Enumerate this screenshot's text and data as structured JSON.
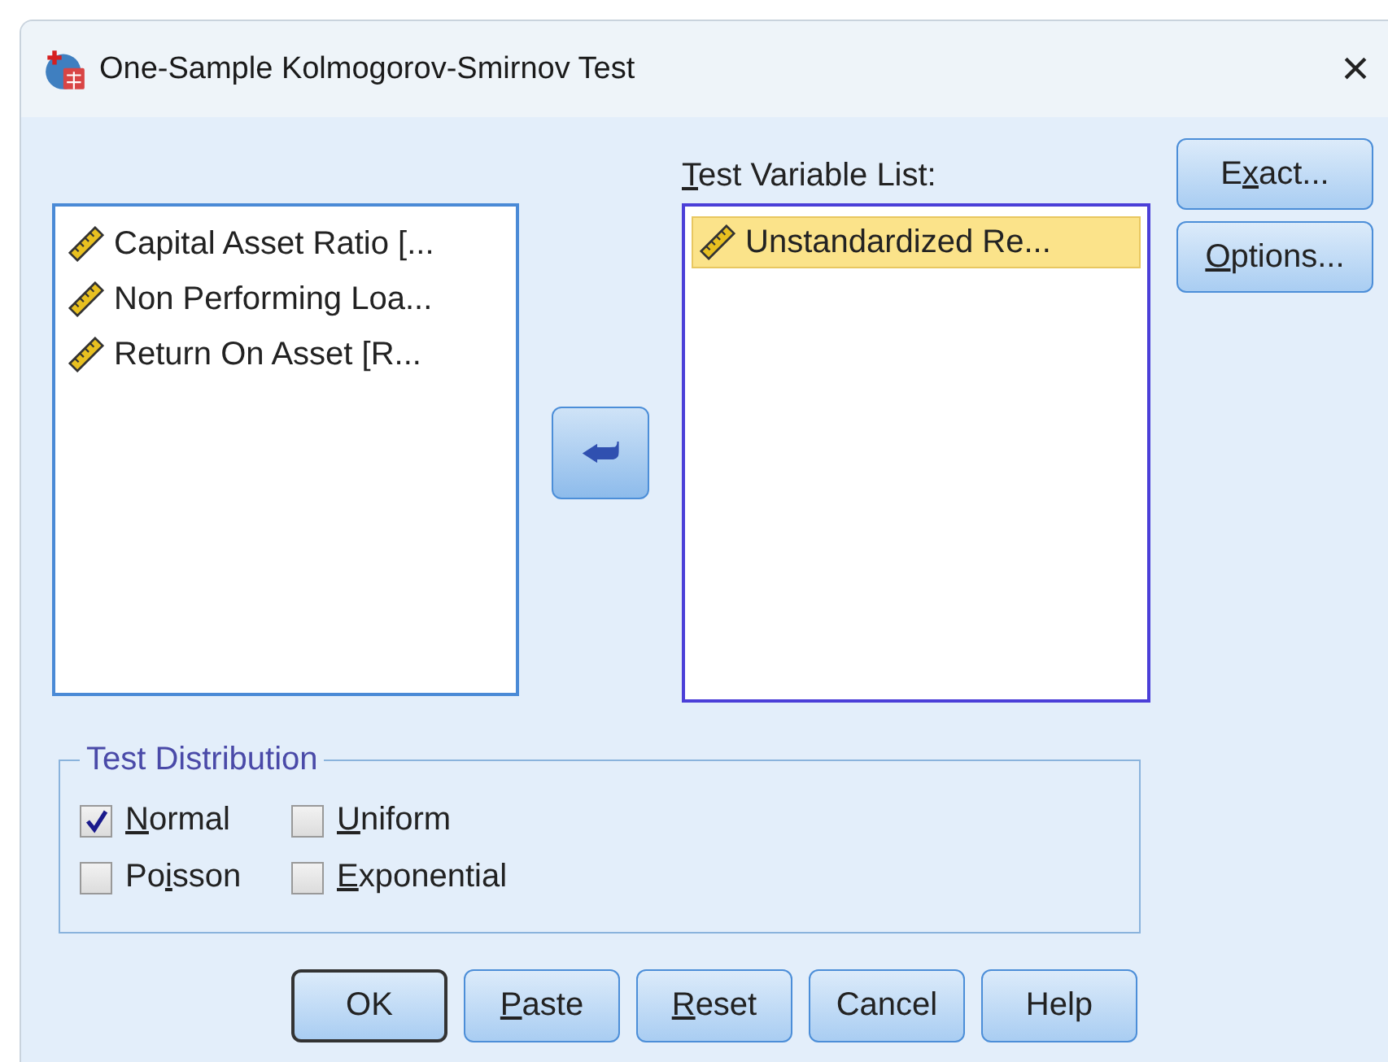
{
  "window": {
    "title": "One-Sample Kolmogorov-Smirnov Test",
    "close": "×"
  },
  "source_list": {
    "items": [
      {
        "label": "Capital Asset Ratio [...",
        "selected": false
      },
      {
        "label": "Non Performing Loa...",
        "selected": false
      },
      {
        "label": "Return On Asset [R...",
        "selected": false
      }
    ]
  },
  "move_button": {
    "glyph": "⮨"
  },
  "test_list": {
    "label": {
      "mnemonic": "T",
      "rest": "est Variable List:"
    },
    "items": [
      {
        "label": "Unstandardized Re...",
        "selected": true
      }
    ]
  },
  "side_buttons": [
    {
      "label": {
        "lead": "E",
        "mnemonic": "x",
        "rest": "act..."
      }
    },
    {
      "label": {
        "mnemonic": "O",
        "rest": "ptions..."
      }
    }
  ],
  "test_distribution": {
    "title": "Test Distribution",
    "options": [
      {
        "label": {
          "mnemonic": "N",
          "rest": "ormal"
        },
        "checked": true
      },
      {
        "label": {
          "mnemonic": "U",
          "rest": "niform"
        },
        "checked": false
      },
      {
        "label": {
          "lead": "Po",
          "mnemonic": "i",
          "rest": "sson"
        },
        "checked": false
      },
      {
        "label": {
          "mnemonic": "E",
          "rest": "xponential"
        },
        "checked": false
      }
    ]
  },
  "buttons": [
    {
      "label": {
        "lead": "OK"
      },
      "default": true
    },
    {
      "label": {
        "mnemonic": "P",
        "rest": "aste"
      },
      "default": false
    },
    {
      "label": {
        "mnemonic": "R",
        "rest": "eset"
      },
      "default": false
    },
    {
      "label": {
        "lead": "Cancel"
      },
      "default": false
    },
    {
      "label": {
        "lead": "Help"
      },
      "default": false
    }
  ]
}
